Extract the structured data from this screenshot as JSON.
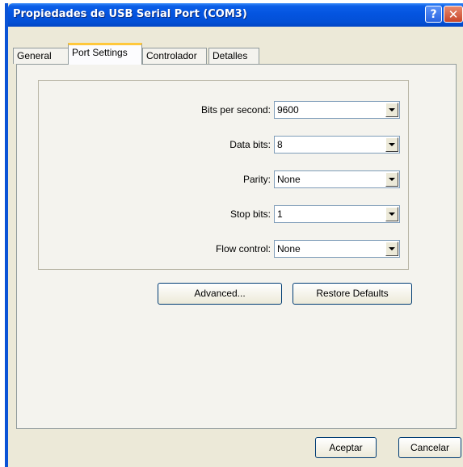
{
  "window": {
    "title": "Propiedades de USB Serial Port (COM3)",
    "help_glyph": "?",
    "close_glyph": "✕"
  },
  "tabs": [
    {
      "label": "General",
      "active": false
    },
    {
      "label": "Port Settings",
      "active": true
    },
    {
      "label": "Controlador",
      "active": false
    },
    {
      "label": "Detalles",
      "active": false
    }
  ],
  "settings": {
    "bits_per_second": {
      "label": "Bits per second:",
      "value": "9600"
    },
    "data_bits": {
      "label": "Data bits:",
      "value": "8"
    },
    "parity": {
      "label": "Parity:",
      "value": "None"
    },
    "stop_bits": {
      "label": "Stop bits:",
      "value": "1"
    },
    "flow_control": {
      "label": "Flow control:",
      "value": "None"
    }
  },
  "buttons": {
    "advanced": "Advanced...",
    "restore_defaults": "Restore Defaults",
    "accept": "Aceptar",
    "cancel": "Cancelar"
  },
  "colors": {
    "titlebar": "#0454e0",
    "face": "#ece9d8",
    "active_tab_highlight": "#ffc83c",
    "close_button": "#c8462a"
  },
  "icons": {
    "help": "question-mark-icon",
    "close": "close-icon",
    "dropdown": "chevron-down-icon"
  }
}
